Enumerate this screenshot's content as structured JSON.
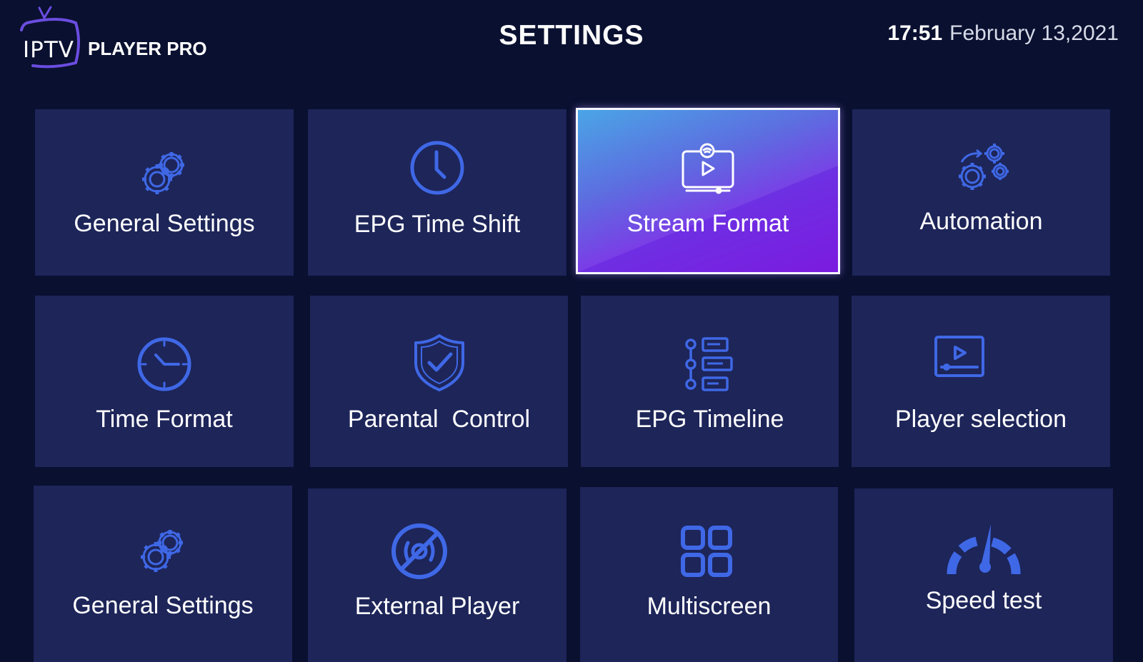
{
  "header": {
    "logo_text": "IPTV",
    "brand_text": "PLAYER PRO",
    "title": "SETTINGS",
    "clock_time": "17:51",
    "clock_date": "February 13,2021"
  },
  "colors": {
    "background": "#0a1030",
    "tile": "#1d2559",
    "icon_blue": "#3f68e6",
    "selected_gradient_start": "#4aa5e6",
    "selected_gradient_end": "#8e1fe0",
    "logo_purple": "#6a4de0"
  },
  "tiles": [
    {
      "id": "general-settings",
      "label": "General Settings",
      "icon": "gears-icon",
      "selected": false
    },
    {
      "id": "epg-time-shift",
      "label": "EPG Time Shift",
      "icon": "clock-icon",
      "selected": false
    },
    {
      "id": "stream-format",
      "label": "Stream Format",
      "icon": "stream-screen-icon",
      "selected": true
    },
    {
      "id": "automation",
      "label": "Automation",
      "icon": "automation-gears-icon",
      "selected": false
    },
    {
      "id": "time-format",
      "label": "Time Format",
      "icon": "clock-face-icon",
      "selected": false
    },
    {
      "id": "parental-control",
      "label": "Parental  Control",
      "icon": "shield-check-icon",
      "selected": false
    },
    {
      "id": "epg-timeline",
      "label": "EPG Timeline",
      "icon": "timeline-icon",
      "selected": false
    },
    {
      "id": "player-selection",
      "label": "Player selection",
      "icon": "player-screen-icon",
      "selected": false
    },
    {
      "id": "general-settings-2",
      "label": "General Settings",
      "icon": "gears-icon",
      "selected": false
    },
    {
      "id": "external-player",
      "label": "External Player",
      "icon": "no-disc-icon",
      "selected": false
    },
    {
      "id": "multiscreen",
      "label": "Multiscreen",
      "icon": "grid-icon",
      "selected": false
    },
    {
      "id": "speed-test",
      "label": "Speed test",
      "icon": "speedometer-icon",
      "selected": false
    }
  ]
}
